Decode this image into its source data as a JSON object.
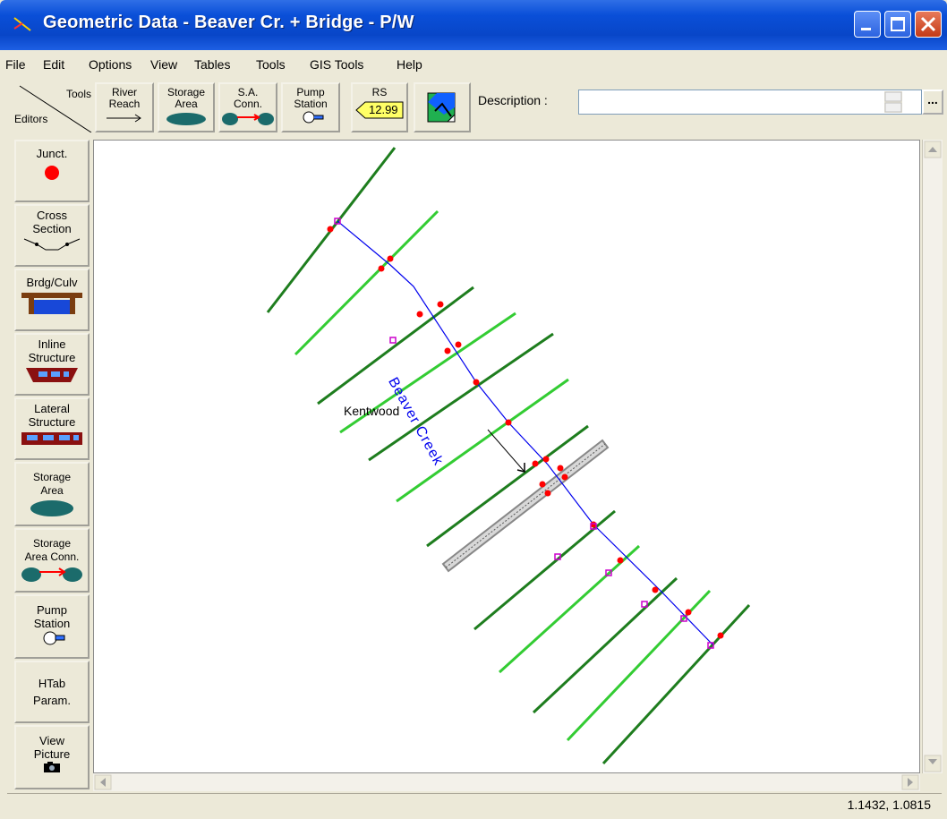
{
  "window": {
    "title": "Geometric Data - Beaver Cr. + Bridge - P/W"
  },
  "menu": [
    "File",
    "Edit",
    "Options",
    "View",
    "Tables",
    "Tools",
    "GIS Tools",
    "Help"
  ],
  "toolbar": {
    "tools_label": "Tools",
    "editors_label": "Editors",
    "river_reach": "River\nReach",
    "storage_area": "Storage\nArea",
    "sa_conn": "S.A.\nConn.",
    "pump_station": "Pump\nStation",
    "rs_label": "RS",
    "rs_value": "12.99",
    "description_label": "Description :",
    "description_value": "",
    "browse_label": "..."
  },
  "editors": [
    {
      "label": "Junct.",
      "icon": "junction-icon"
    },
    {
      "label": "Cross\nSection",
      "icon": "cross-section-icon"
    },
    {
      "label": "Brdg/Culv",
      "icon": "bridge-culvert-icon"
    },
    {
      "label": "Inline\nStructure",
      "icon": "inline-structure-icon"
    },
    {
      "label": "Lateral\nStructure",
      "icon": "lateral-structure-icon"
    },
    {
      "label": "Storage\nArea",
      "icon": "storage-area-icon"
    },
    {
      "label": "Storage\nArea Conn.",
      "icon": "storage-area-conn-icon"
    },
    {
      "label": "Pump\nStation",
      "icon": "pump-station-icon"
    },
    {
      "label": "HTab\nParam.",
      "icon": ""
    },
    {
      "label": "View\nPicture",
      "icon": "camera-icon"
    }
  ],
  "canvas": {
    "river_label": "Beaver Creek",
    "town_label": "Kentwood",
    "colors": {
      "dark_xs": "#1e7d1e",
      "light_xs": "#33cc33",
      "river": "#0000ee",
      "marker": "#ff0000",
      "node": "#cc00cc",
      "bridge": "#888888"
    }
  },
  "status": {
    "coords": "1.1432, 1.0815"
  }
}
